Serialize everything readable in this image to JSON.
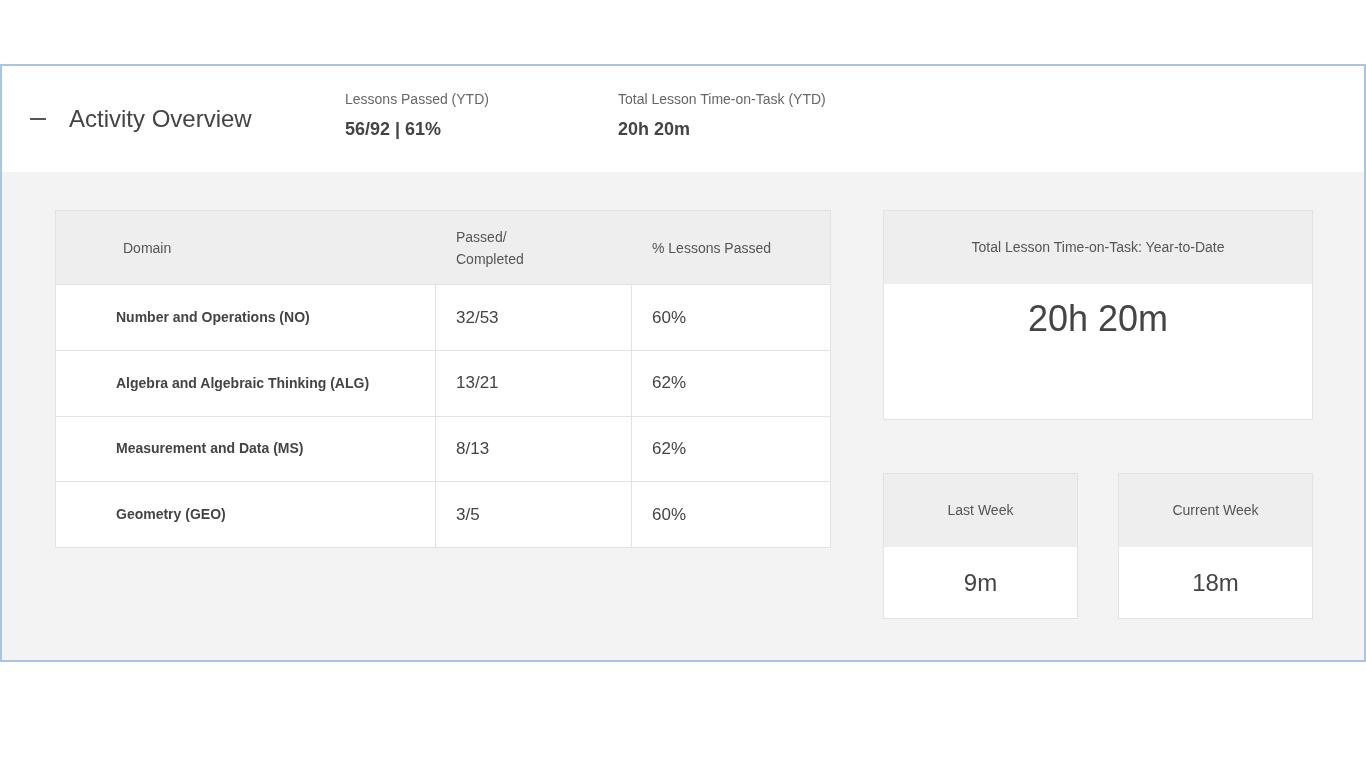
{
  "panel": {
    "title": "Activity Overview",
    "expanded": true
  },
  "summary": [
    {
      "label": "Lessons Passed (YTD)",
      "value": "56/92 | 61%"
    },
    {
      "label": "Total Lesson Time-on-Task (YTD)",
      "value": "20h 20m"
    }
  ],
  "table": {
    "columns": [
      "Domain",
      "Passed/ Completed",
      "% Lessons Passed"
    ],
    "rows": [
      {
        "domain": "Number and Operations (NO)",
        "passed": "32/53",
        "percent": "60%"
      },
      {
        "domain": "Algebra and Algebraic Thinking (ALG)",
        "passed": "13/21",
        "percent": "62%"
      },
      {
        "domain": "Measurement and Data (MS)",
        "passed": "8/13",
        "percent": "62%"
      },
      {
        "domain": "Geometry (GEO)",
        "passed": "3/5",
        "percent": "60%"
      }
    ]
  },
  "time_total": {
    "label": "Total Lesson Time-on-Task: Year-to-Date",
    "value": "20h 20m"
  },
  "weeks": [
    {
      "label": "Last Week",
      "value": "9m"
    },
    {
      "label": "Current Week",
      "value": "18m"
    }
  ]
}
